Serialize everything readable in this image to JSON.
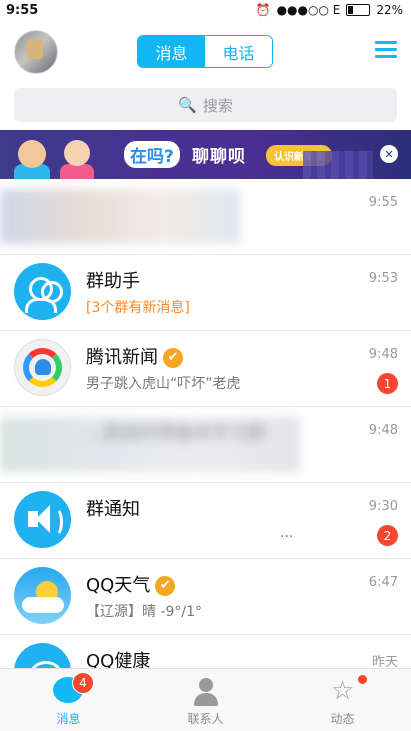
{
  "status_bar": {
    "time": "9:55",
    "carrier": "●●●○○ E",
    "battery": "22%",
    "battery_level": 0.22
  },
  "header": {
    "tab_messages": "消息",
    "tab_phone": "电话"
  },
  "search": {
    "placeholder": "搜索"
  },
  "banner": {
    "bubble": "在吗?",
    "text": "聊聊呗",
    "button": "认识新朋友"
  },
  "conversations": [
    {
      "title": "",
      "subtitle": "",
      "time": "9:55",
      "badge": ""
    },
    {
      "title": "群助手",
      "subtitle": "[3个群有新消息]",
      "time": "9:53",
      "badge": ""
    },
    {
      "title": "腾讯新闻",
      "subtitle": "男子跳入虎山“吓坏”老虎",
      "time": "9:48",
      "badge": "1"
    },
    {
      "title": "...高级的预备班学习群",
      "subtitle": "",
      "time": "9:48",
      "badge": ""
    },
    {
      "title": "群通知",
      "subtitle": "...",
      "time": "9:30",
      "badge": "2"
    },
    {
      "title": "QQ天气",
      "subtitle": "【辽源】晴 -9°/1°",
      "time": "6:47",
      "badge": ""
    },
    {
      "title": "QQ健康",
      "subtitle": "",
      "time": "昨天",
      "badge": ""
    }
  ],
  "tabbar": {
    "messages": "消息",
    "contacts": "联系人",
    "dynamics": "动态",
    "messages_badge": "4"
  }
}
